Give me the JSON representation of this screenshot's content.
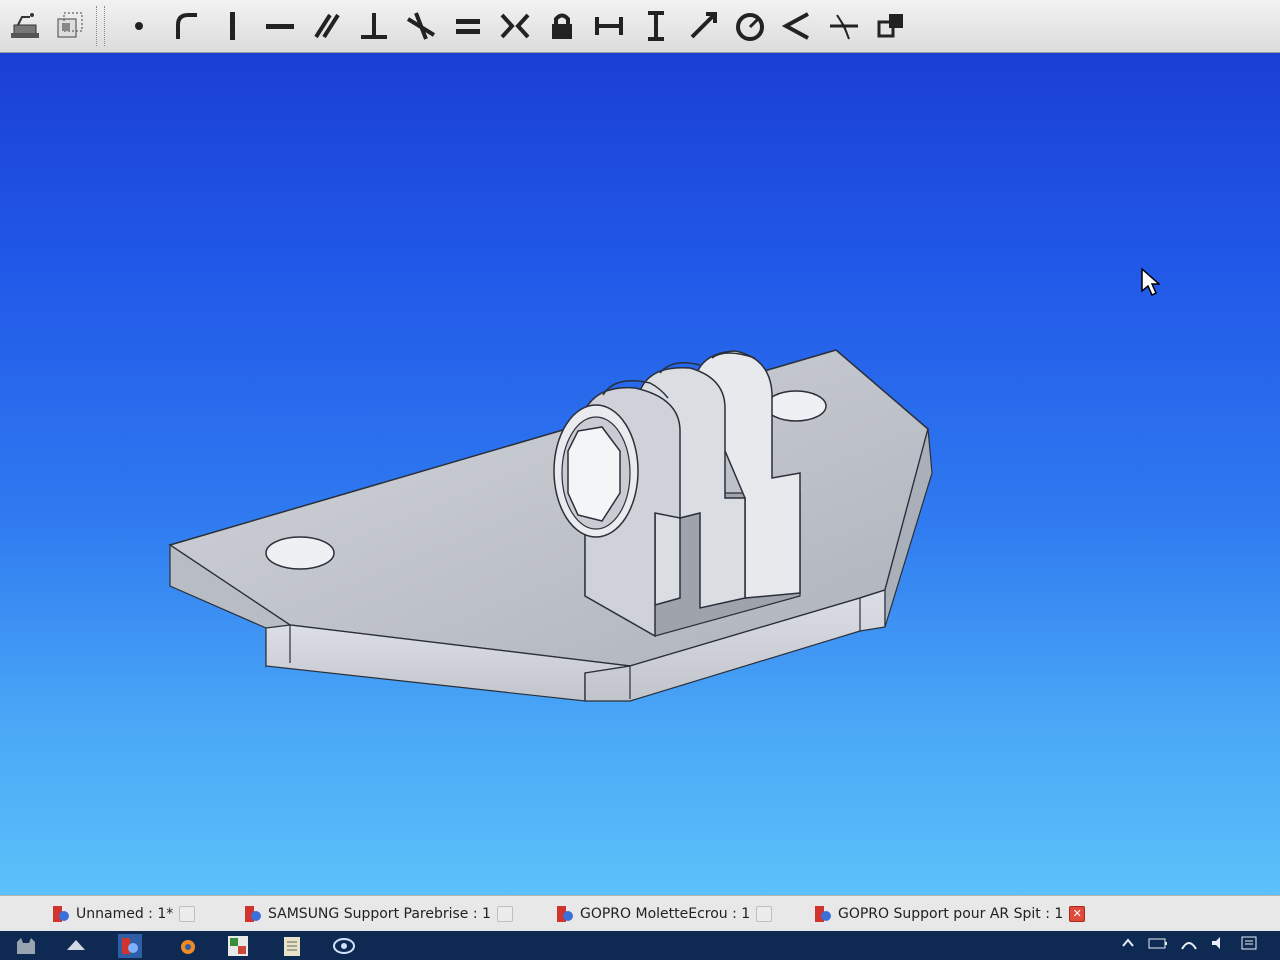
{
  "toolbar": {
    "left_icons": [
      "sketcher-icon",
      "view-sketch-icon"
    ],
    "constraint_icons": [
      "point-on-object-icon",
      "tangent-icon",
      "vertical-icon",
      "horizontal-icon",
      "parallel-icon",
      "perpendicular-icon",
      "tangent-line-icon",
      "equal-icon",
      "symmetric-icon",
      "lock-icon",
      "horizontal-distance-icon",
      "vertical-distance-icon",
      "distance-icon",
      "radius-icon",
      "angle-icon",
      "snell-law-icon",
      "toggle-construction-icon"
    ]
  },
  "tabs": [
    {
      "label": "Unnamed : 1*",
      "close_red": false
    },
    {
      "label": "SAMSUNG Support Parebrise : 1",
      "close_red": false
    },
    {
      "label": "GOPRO MoletteEcrou : 1",
      "close_red": false
    },
    {
      "label": "GOPRO Support pour AR Spit : 1",
      "close_red": true
    }
  ],
  "taskbar": {
    "apps": [
      "cat-icon",
      "freecad-icon",
      "blender-icon",
      "photos-icon",
      "notepad-icon",
      "browser-icon"
    ],
    "tray": [
      "chevron-up-icon",
      "battery-icon",
      "wifi-icon",
      "volume-icon",
      "notifications-icon"
    ]
  },
  "colors": {
    "viewport_top": "#1b3fd6",
    "viewport_bottom": "#5cc1fa",
    "model_face": "#c9ccd3",
    "model_edge": "#2a2f3a"
  }
}
